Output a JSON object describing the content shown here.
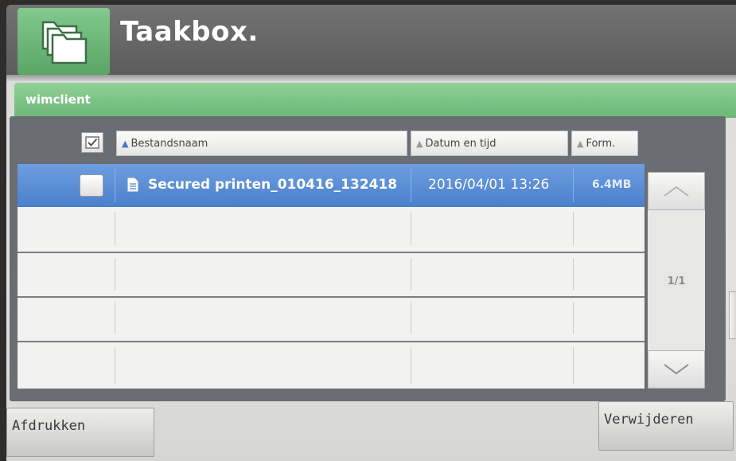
{
  "header": {
    "title": "Taakbox.",
    "icon": "folders-icon"
  },
  "box": {
    "name": "wimclient"
  },
  "columns": {
    "filename": "Bestandsnaam",
    "datetime": "Datum en tijd",
    "format": "Form."
  },
  "files": [
    {
      "name": "Secured printen_010416_132418",
      "datetime": "2016/04/01 13:26",
      "size": "6.4MB",
      "selected": true
    }
  ],
  "pagination": {
    "page": "1/1"
  },
  "actions": {
    "print_label": "Afdrukken",
    "delete_label": "Verwijderen"
  },
  "colors": {
    "header_bg": "#5c5c5c",
    "accent_green": "#6db777",
    "selected_row": "#4a7fcb"
  }
}
